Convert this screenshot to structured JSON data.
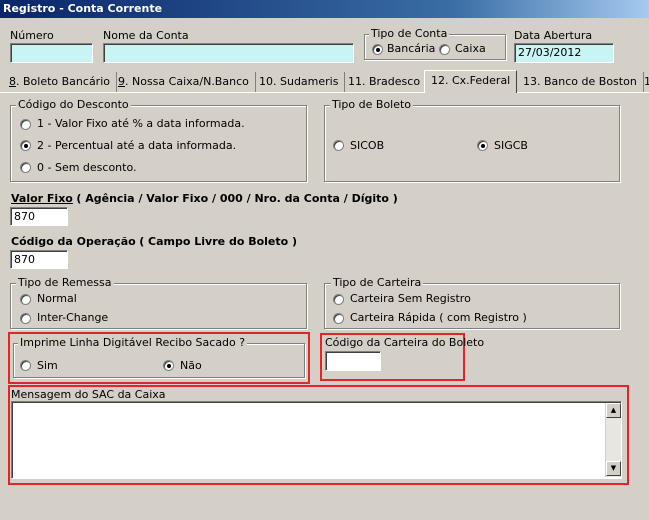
{
  "window": {
    "title": "Registro - Conta Corrente"
  },
  "header": {
    "numero_label": "Número",
    "numero_value": "",
    "nome_label": "Nome da Conta",
    "nome_value": "",
    "tipo_conta_label": "Tipo de Conta",
    "tipo_conta_options": [
      "Bancária",
      "Caixa"
    ],
    "data_abertura_label": "Data Abertura",
    "data_abertura_value": "27/03/2012"
  },
  "tabs": [
    {
      "prefix": "8",
      "label": ". Boleto Bancário"
    },
    {
      "prefix": "9",
      "label": ". Nossa Caixa/N.Banco"
    },
    {
      "prefix": "10",
      "label": ". Sudameris"
    },
    {
      "prefix": "11",
      "label": ". Bradesco"
    },
    {
      "prefix": "12",
      "label": ". Cx.Federal"
    },
    {
      "prefix": "13",
      "label": ". Banco de Boston"
    },
    {
      "prefix": "1",
      "label": ""
    }
  ],
  "desconto": {
    "legend": "Código do Desconto",
    "options": [
      "1 - Valor Fixo até % a data informada.",
      "2 - Percentual até  a data informada.",
      "0 - Sem desconto."
    ]
  },
  "boleto": {
    "legend": "Tipo de Boleto",
    "options": [
      "SICOB",
      "SIGCB"
    ]
  },
  "valor_fixo": {
    "label": "Valor Fixo",
    "hint": "( Agência / Valor Fixo / 000 / Nro. da Conta / Dígito )",
    "value": "870"
  },
  "operacao": {
    "label": "Código da Operação",
    "hint": "( Campo Livre do Boleto )",
    "value": "870"
  },
  "remessa": {
    "legend": "Tipo de Remessa",
    "options": [
      "Normal",
      "Inter-Change"
    ]
  },
  "carteira": {
    "legend": "Tipo de Carteira",
    "options": [
      "Carteira Sem Registro",
      "Carteira Rápida ( com Registro )"
    ]
  },
  "imprime": {
    "legend": "Imprime Linha Digitável Recibo Sacado ?",
    "options": [
      "Sim",
      "Não"
    ]
  },
  "codigo_carteira": {
    "label": "Código da Carteira do Boleto",
    "value": ""
  },
  "sac": {
    "label": "Mensagem do SAC da Caixa",
    "value": ""
  },
  "colors": {
    "highlight": "#e0262a",
    "field_cyan": "#c8f4f4",
    "title": "#0a246a"
  }
}
